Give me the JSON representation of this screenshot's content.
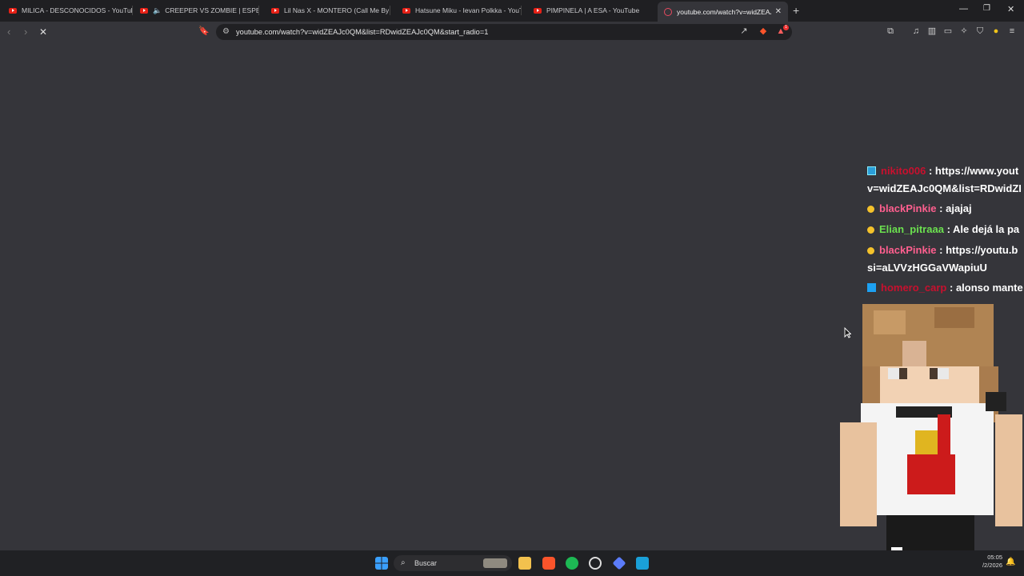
{
  "tabs": [
    {
      "label": "MILICA - DESCONOCIDOS - YouTube"
    },
    {
      "label": "CREEPER VS ZOMBIE | ESPECIAL"
    },
    {
      "label": "Lil Nas X - MONTERO (Call Me By Yo"
    },
    {
      "label": "Hatsune Miku - Ievan Polkka - YouTu"
    },
    {
      "label": "PIMPINELA | A ESA - YouTube"
    },
    {
      "label": "youtube.com/watch?v=widZEAJc"
    }
  ],
  "address_bar": {
    "url": "youtube.com/watch?v=widZEAJc0QM&list=RDwidZEAJc0QM&start_radio=1"
  },
  "extension_badge": "1",
  "chat": [
    {
      "user": "nikito006",
      "text": ": https://www.yout",
      "text2": "v=widZEAJc0QM&list=RDwidZI"
    },
    {
      "user": "blackPinkie",
      "text": ": ajajaj"
    },
    {
      "user": "Elian_pitraaa",
      "text": ": Ale dejá la pa"
    },
    {
      "user": "blackPinkie",
      "text": ": https://youtu.b",
      "text2": "si=aLVVzHGGaVWapiuU"
    },
    {
      "user": "homero_carp",
      "text": ": alonso mante"
    }
  ],
  "taskbar": {
    "search_placeholder": "Buscar",
    "time": "05:05",
    "date": "/2/2026"
  },
  "colors": {
    "background": "#35353a",
    "tab_strip": "#1f1f22",
    "taskbar": "#202124",
    "youtube_red": "#e62117"
  }
}
